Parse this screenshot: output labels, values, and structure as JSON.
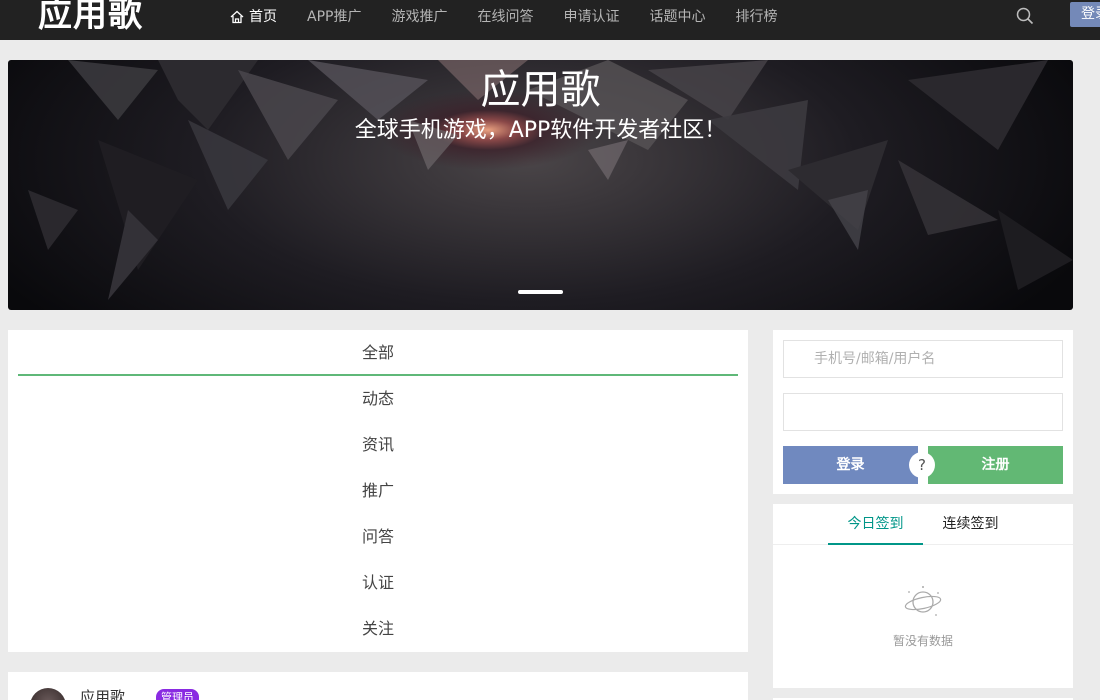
{
  "header": {
    "logo": "应用歌",
    "nav": [
      {
        "label": "首页",
        "active": true
      },
      {
        "label": "APP推广"
      },
      {
        "label": "游戏推广"
      },
      {
        "label": "在线问答"
      },
      {
        "label": "申请认证"
      },
      {
        "label": "话题中心"
      },
      {
        "label": "排行榜"
      }
    ],
    "login_label": "登录",
    "icons": {
      "home": "home-icon",
      "search": "search-icon"
    }
  },
  "banner": {
    "title": "应用歌",
    "subtitle": "全球手机游戏，APP软件开发者社区！"
  },
  "categories": [
    "全部",
    "动态",
    "资讯",
    "推广",
    "问答",
    "认证",
    "关注"
  ],
  "active_category": "全部",
  "post": {
    "author": "应用歌",
    "badge": "管理员"
  },
  "login_form": {
    "username_placeholder": "手机号/邮箱/用户名",
    "password_placeholder": "",
    "login_button": "登录",
    "register_button": "注册",
    "help_label": "?"
  },
  "sign_in": {
    "tabs": [
      "今日签到",
      "连续签到"
    ],
    "active_tab": "今日签到",
    "empty_text": "暂没有数据"
  },
  "colors": {
    "topbar": "#222222",
    "accent_green": "#5fb878",
    "login_blue": "#7089bf",
    "register_green": "#62b874",
    "tab_teal": "#009688",
    "badge_purple": "#8a2be2"
  }
}
